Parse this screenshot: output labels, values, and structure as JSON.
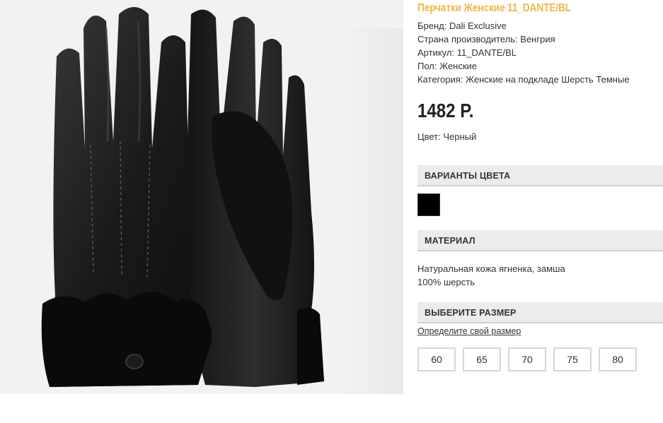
{
  "product": {
    "title": "Перчатки Женские 11_DANTE/BL",
    "specs": [
      "Бренд: Dali Exclusive",
      "Страна производитель: Венгрия",
      "Артикул: 11_DANTE/BL",
      "Пол: Женские",
      "Категория: Женские на подкладе Шерсть Темные"
    ],
    "price": "1482 Р.",
    "color": "Цвет: Черный"
  },
  "sections": {
    "color_variants": "ВАРИАНТЫ ЦВЕТА",
    "material": "МАТЕРИАЛ",
    "size": "ВЫБЕРИТЕ РАЗМЕР"
  },
  "color_swatches": [
    {
      "color": "#000000"
    }
  ],
  "material_lines": [
    "Натуральная кожа ягненка, замша",
    "100% шерсть"
  ],
  "size_link": "Определите свой размер",
  "sizes": [
    "60",
    "65",
    "70",
    "75",
    "80"
  ],
  "colors": {
    "title": "#f0b64b",
    "section_bg": "#ececec",
    "page_bg": "#ffffff",
    "image_bg": "#f2f2f2"
  }
}
